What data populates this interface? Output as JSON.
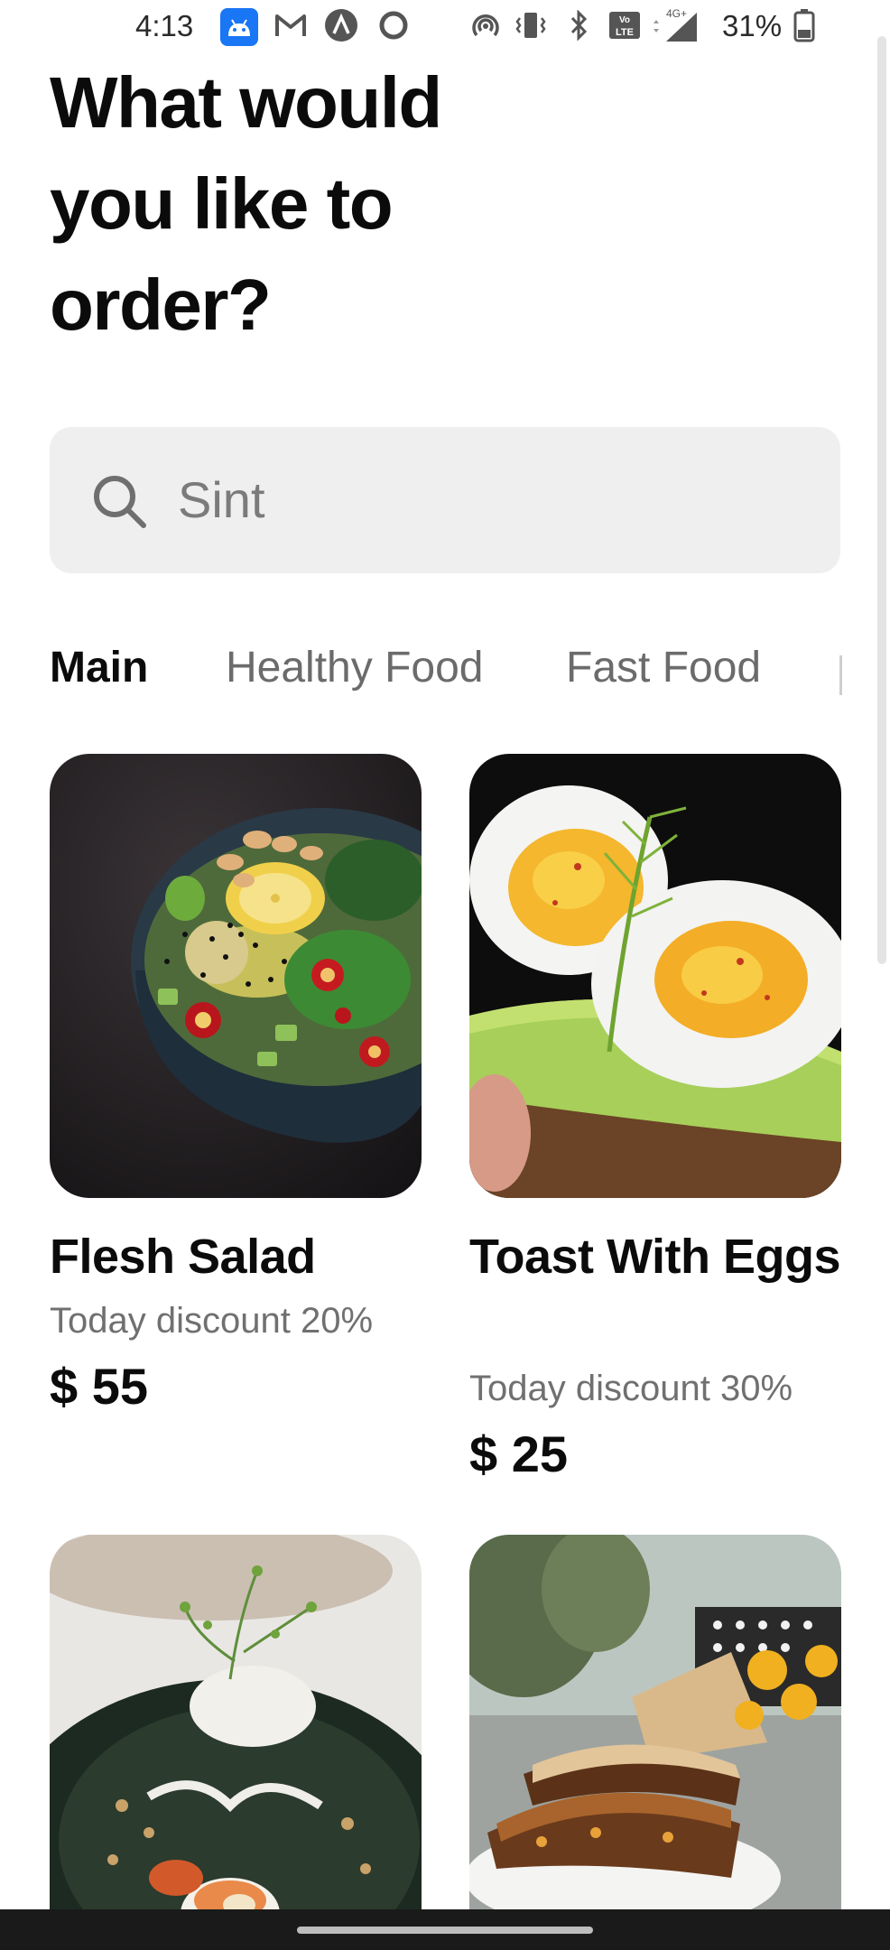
{
  "status_bar": {
    "time": "4:13",
    "network": "4G+",
    "battery_percent": "31%",
    "volte_label": "Vo LTE"
  },
  "title": "What would you like to order?",
  "search": {
    "value": "Sint",
    "icon": "search-icon"
  },
  "tabs": [
    {
      "label": "Main",
      "active": true
    },
    {
      "label": "Healthy Food",
      "active": false
    },
    {
      "label": "Fast Food",
      "active": false
    }
  ],
  "products": [
    {
      "name": "Flesh Salad",
      "discount": "Today discount 20%",
      "price": "$ 55",
      "image": "salad bowl"
    },
    {
      "name": "Toast With Eggs",
      "discount": "Today discount 30%",
      "price": "$ 25",
      "image": "egg avocado toast"
    },
    {
      "name": "",
      "discount": "",
      "price": "",
      "image": "sushi salad plate"
    },
    {
      "name": "",
      "discount": "",
      "price": "",
      "image": "grilled sandwich plate"
    }
  ],
  "colors": {
    "search_bg": "#efefef",
    "active_tab": "#0b0b0b",
    "inactive_tab": "#6b6b6b",
    "status_accent": "#1976f5"
  }
}
